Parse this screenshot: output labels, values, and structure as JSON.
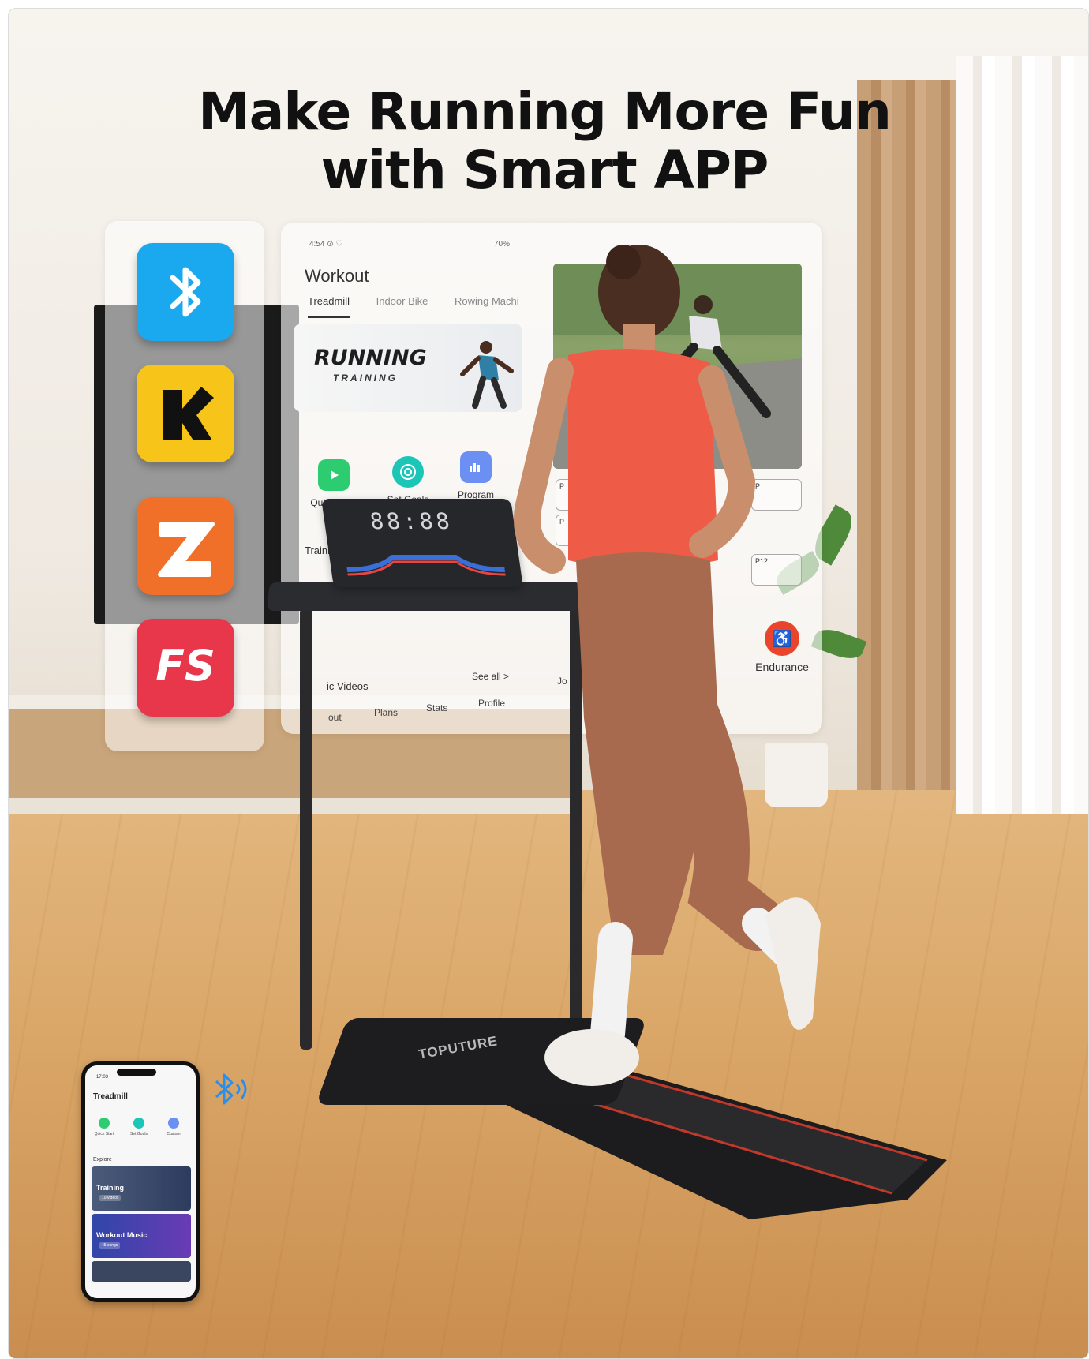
{
  "headline": {
    "line1": "Make Running More Fun",
    "line2": "with Smart APP"
  },
  "compatible_apps": [
    {
      "name": "bluetooth-icon",
      "color": "#1aa9ee"
    },
    {
      "name": "kinomap-icon",
      "color": "#f7c51a"
    },
    {
      "name": "zwift-icon",
      "color": "#f0702a"
    },
    {
      "name": "fitshow-icon",
      "color": "#e8364a"
    }
  ],
  "app_panel": {
    "status_time": "4:54 ⊙ ♡",
    "status_battery": "70%",
    "title": "Workout",
    "tabs": [
      "Treadmill",
      "Indoor Bike",
      "Rowing Machi"
    ],
    "banner_title": "RUNNING",
    "banner_subtitle": "TRAINING",
    "quick_actions": [
      "Quick Start",
      "Set Goals",
      "Program"
    ],
    "training_label": "Training",
    "videos_label": "ic Videos",
    "see_all": "See all >",
    "nav": [
      "out",
      "Plans",
      "Stats",
      "Profile"
    ],
    "jo_label": "Jo",
    "program_cards": [
      "P",
      "P",
      "P",
      "P12"
    ],
    "endurance_label": "Endurance"
  },
  "console": {
    "display": "88:88"
  },
  "treadmill": {
    "brand": "TOPUTURE"
  },
  "phone": {
    "time": "17:03",
    "title": "Treadmill",
    "quick_actions": [
      "Quick Start",
      "Set Goals",
      "Custom"
    ],
    "explore_label": "Explore",
    "cards": [
      {
        "title": "Training",
        "subtitle": "10 videos"
      },
      {
        "title": "Workout Music",
        "subtitle": "45 songs"
      }
    ]
  },
  "colors": {
    "accent_red": "#e8452c",
    "dark": "#111111"
  }
}
